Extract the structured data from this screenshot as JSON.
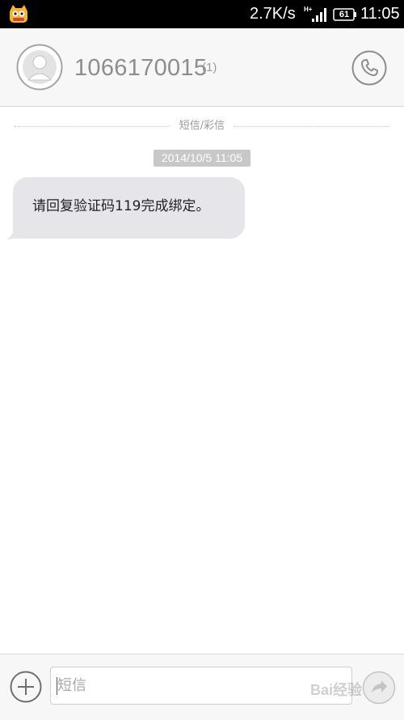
{
  "status_bar": {
    "app_icon": "cat-mascot-icon",
    "net_speed": "2.7K/s",
    "network_type": "H+",
    "battery_level": "61",
    "time": "11:05"
  },
  "header": {
    "contact_number": "1066170015",
    "message_count": "(1)",
    "avatar_icon": "person-avatar-icon",
    "call_icon": "phone-icon"
  },
  "conversation": {
    "divider_label": "短信/彩信",
    "messages": [
      {
        "timestamp": "2014/10/5 11:05",
        "text": "请回复验证码119完成绑定。",
        "direction": "incoming"
      }
    ]
  },
  "input_bar": {
    "add_icon": "plus-circle-icon",
    "placeholder": "短信",
    "send_icon": "send-arrow-icon",
    "watermark": "Bai经验"
  },
  "colors": {
    "status_bar_bg": "#000000",
    "header_bg": "#f7f7f7",
    "bubble_bg": "#e6e6ea",
    "timestamp_bg": "#c8c8c8",
    "icon_gray": "#8d8d8d"
  }
}
